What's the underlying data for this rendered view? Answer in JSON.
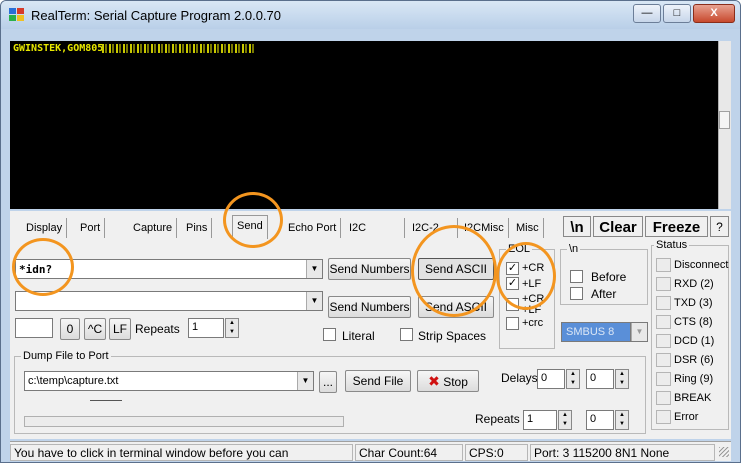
{
  "window": {
    "title": "RealTerm: Serial Capture Program 2.0.0.70",
    "minimize_glyph": "—",
    "maximize_glyph": "□",
    "close_glyph": "X"
  },
  "terminal": {
    "text": "GWINSTEK,GOM805"
  },
  "tabs": [
    {
      "label": "Display",
      "active": false
    },
    {
      "label": "Port",
      "active": false
    },
    {
      "label": "Capture",
      "active": false
    },
    {
      "label": "Pins",
      "active": false
    },
    {
      "label": "Send",
      "active": true
    },
    {
      "label": "Echo Port",
      "active": false
    },
    {
      "label": "I2C",
      "active": false
    },
    {
      "label": "I2C-2",
      "active": false
    },
    {
      "label": "I2CMisc",
      "active": false
    },
    {
      "label": "Misc",
      "active": false
    }
  ],
  "toolbar": {
    "newline_label": "\\n",
    "clear_label": "Clear",
    "freeze_label": "Freeze",
    "help_label": "?"
  },
  "send": {
    "line1_value": "*idn?",
    "line2_value": "",
    "send_numbers_label": "Send Numbers",
    "send_ascii_label": "Send ASCII",
    "zero_label": "0",
    "ctrl_c_label": "^C",
    "lf_label": "LF",
    "repeats_label": "Repeats",
    "repeats_value": "1",
    "literal_label": "Literal",
    "strip_spaces_label": "Strip Spaces"
  },
  "eol": {
    "legend": "EOL",
    "items": [
      {
        "label": "+CR",
        "checked": true
      },
      {
        "label": "+LF",
        "checked": true
      },
      {
        "label": "+CR",
        "checked": false
      },
      {
        "label": "+LF",
        "checked": false
      },
      {
        "label": "+crc",
        "checked": false
      }
    ]
  },
  "newline_group": {
    "legend": "\\n",
    "before_label": "Before",
    "after_label": "After",
    "smbus_value": "SMBUS 8"
  },
  "dump": {
    "legend": "Dump File to Port",
    "file_value": "c:\\temp\\capture.txt",
    "browse_label": "...",
    "send_file_label": "Send File",
    "stop_label": "Stop",
    "stop_icon": "red-x",
    "delays_label": "Delays",
    "delays_value1": "0",
    "delays_value2": "0",
    "repeats_label": "Repeats",
    "repeats_value1": "1",
    "repeats_value2": "0"
  },
  "status": {
    "legend": "Status",
    "items": [
      "Disconnect",
      "RXD (2)",
      "TXD (3)",
      "CTS (8)",
      "DCD (1)",
      "DSR (6)",
      "Ring (9)",
      "BREAK",
      "Error"
    ]
  },
  "statusbar": {
    "message": "You have to click in terminal window before you can",
    "char_count": "Char Count:64",
    "cps": "CPS:0",
    "port": "Port: 3 115200 8N1 None"
  },
  "colors": {
    "highlight": "#f3951f",
    "terminal_text": "#e8e800",
    "terminal_bg": "#000000"
  }
}
